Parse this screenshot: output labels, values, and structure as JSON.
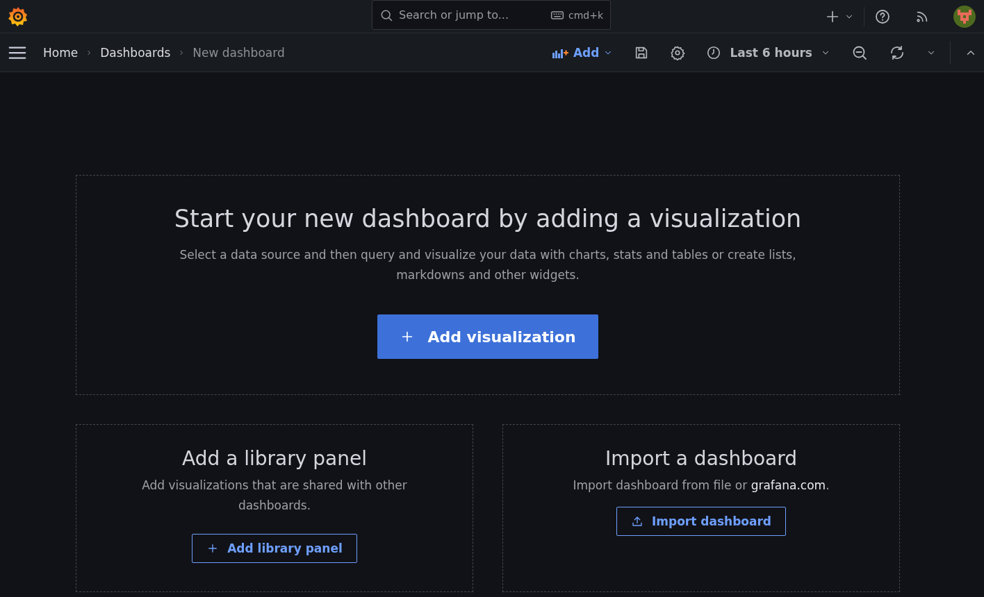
{
  "top_bar": {
    "search": {
      "placeholder": "Search or jump to...",
      "shortcut": "cmd+k"
    }
  },
  "breadcrumbs": [
    {
      "label": "Home",
      "current": false
    },
    {
      "label": "Dashboards",
      "current": false
    },
    {
      "label": "New dashboard",
      "current": true
    }
  ],
  "toolbar": {
    "add_label": "Add",
    "time_range": "Last 6 hours"
  },
  "empty_state": {
    "title": "Start your new dashboard by adding a visualization",
    "text": "Select a data source and then query and visualize your data with charts, stats and tables or create lists, markdowns and other widgets.",
    "button": "Add visualization"
  },
  "cards": [
    {
      "kind": "library",
      "title": "Add a library panel",
      "text": "Add visualizations that are shared with other dashboards.",
      "button": "Add library panel"
    },
    {
      "kind": "import",
      "title": "Import a dashboard",
      "text": "Import dashboard from file or ",
      "link": "grafana.com",
      "text_end": ".",
      "button": "Import dashboard"
    }
  ]
}
